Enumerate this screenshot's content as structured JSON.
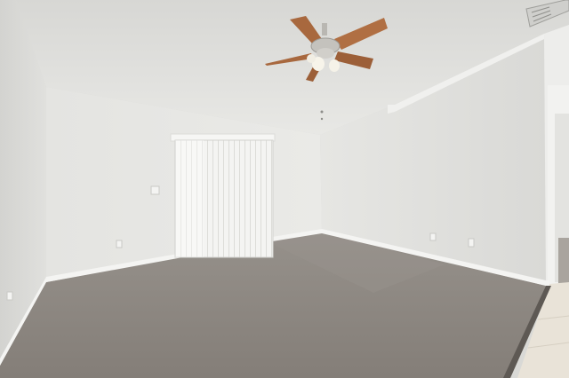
{
  "scene": {
    "kind": "photo",
    "subject": "empty-room-interior",
    "colors": {
      "ceiling": "#e4e4e1",
      "wall_left": "#dcdcd9",
      "wall_back": "#e6e6e3",
      "wall_right": "#e1e1de",
      "carpet": "#8c8680",
      "baseboard": "#f4f4f2",
      "tile": "#e9e3d8",
      "fan_blade": "#a8683e",
      "fan_metal": "#b9b7b2",
      "blind": "#f3f3f1"
    }
  }
}
